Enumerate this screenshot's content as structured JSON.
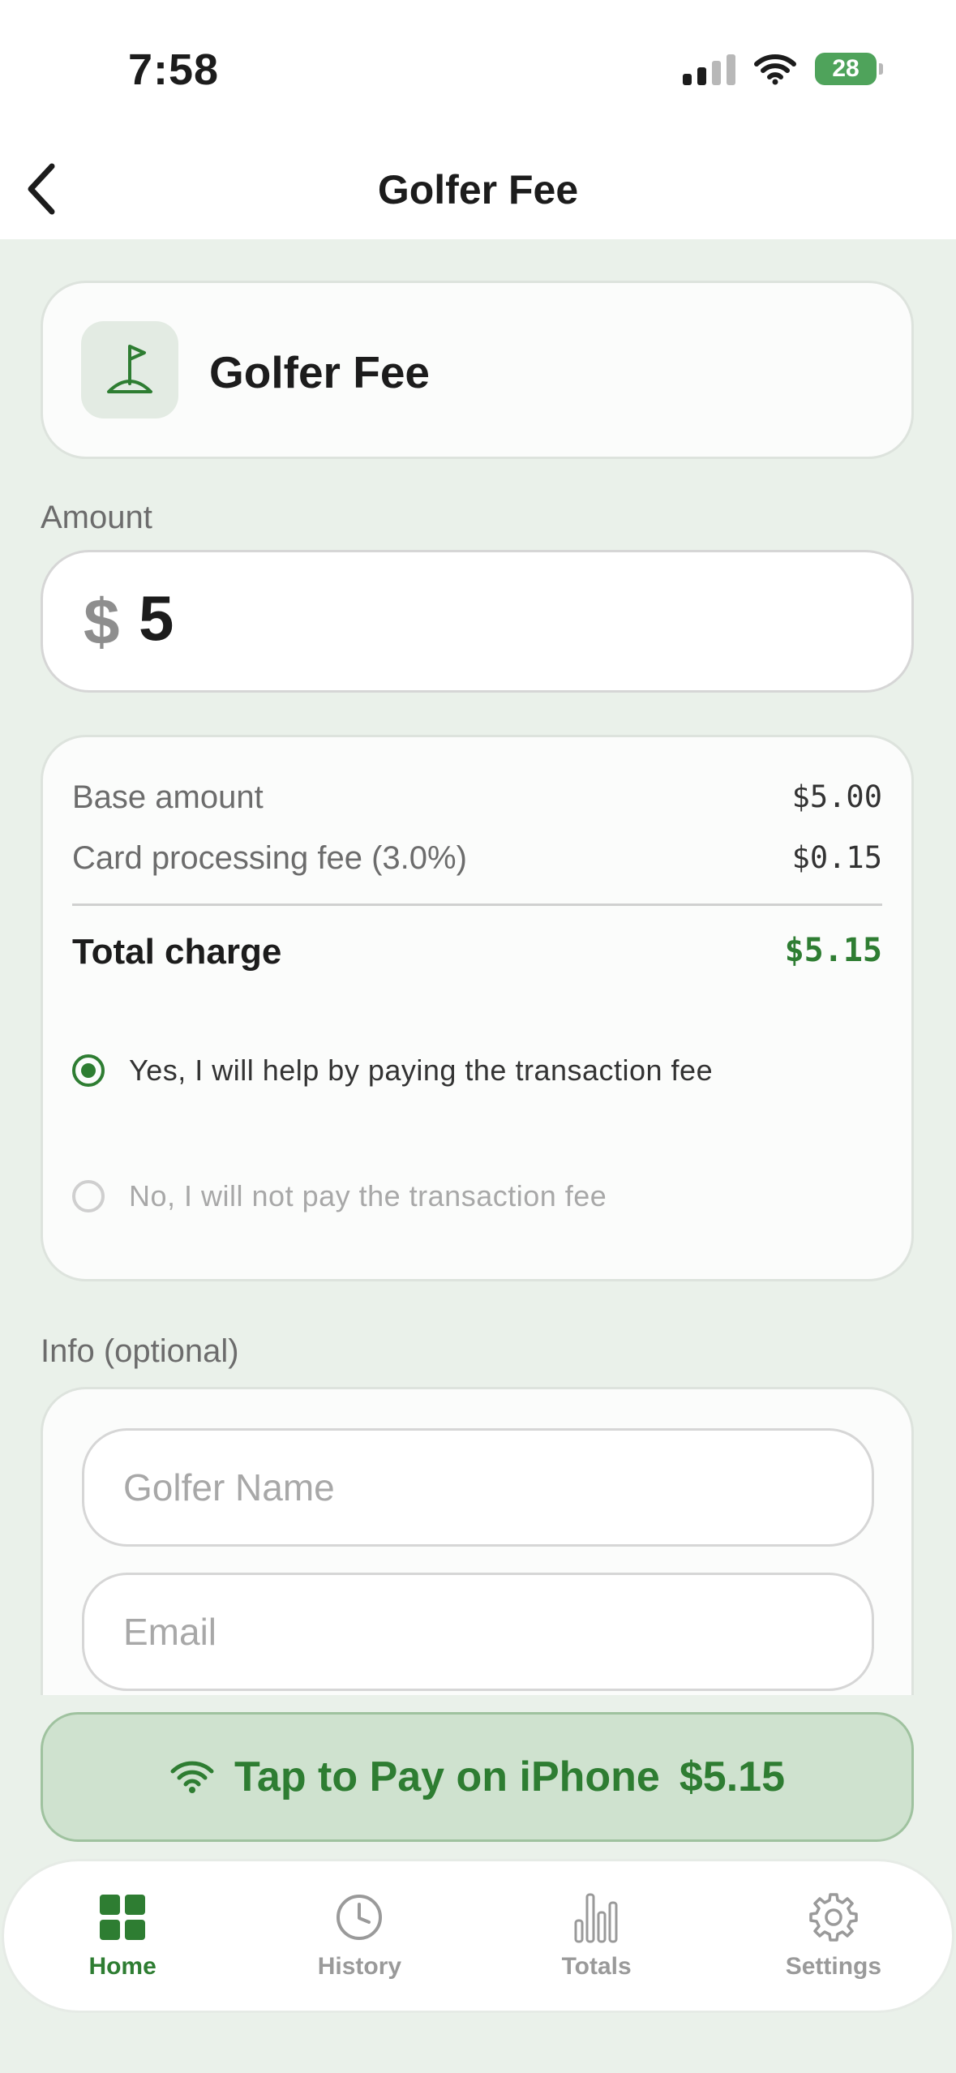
{
  "status_bar": {
    "time": "7:58",
    "battery": "28"
  },
  "nav": {
    "title": "Golfer Fee"
  },
  "product": {
    "name": "Golfer Fee"
  },
  "amount": {
    "label": "Amount",
    "currency": "$",
    "value": "5"
  },
  "fees": {
    "base_label": "Base amount",
    "base_value": "$5.00",
    "processing_label": "Card processing fee (3.0%)",
    "processing_value": "$0.15",
    "total_label": "Total charge",
    "total_value": "$5.15"
  },
  "fee_options": [
    {
      "label": "Yes, I will help by paying the transaction fee",
      "selected": true
    },
    {
      "label": "No, I will not pay the transaction fee",
      "selected": false
    }
  ],
  "info": {
    "label": "Info (optional)",
    "name_placeholder": "Golfer Name",
    "email_placeholder": "Email"
  },
  "pay_button": {
    "label": "Tap to Pay on iPhone",
    "amount": "$5.15"
  },
  "tabs": [
    {
      "label": "Home",
      "icon": "grid-icon",
      "active": true
    },
    {
      "label": "History",
      "icon": "clock-icon",
      "active": false
    },
    {
      "label": "Totals",
      "icon": "bar-chart-icon",
      "active": false
    },
    {
      "label": "Settings",
      "icon": "gear-icon",
      "active": false
    }
  ],
  "colors": {
    "accent": "#2e7d32",
    "background": "#eaf1ea",
    "button_bg": "#cfe2cf"
  }
}
